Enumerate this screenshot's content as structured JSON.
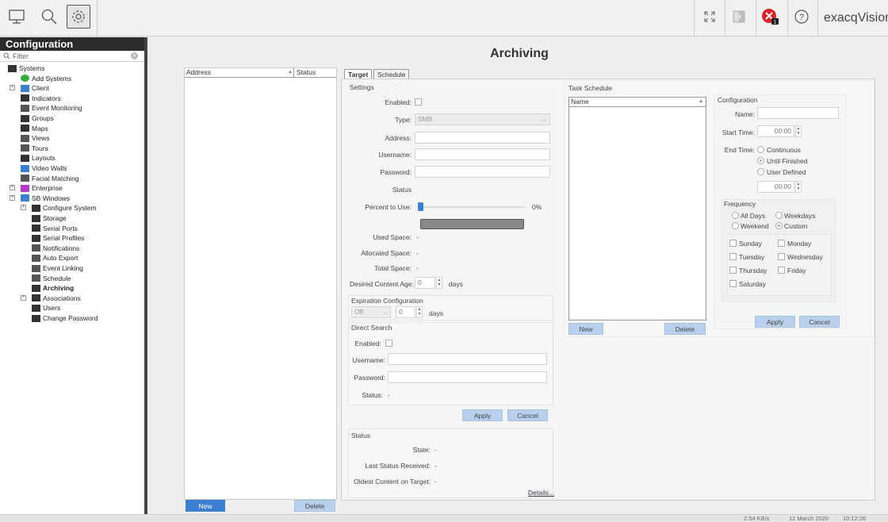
{
  "toolbar": {
    "brand": "exacqVision"
  },
  "sidebar": {
    "title": "Configuration",
    "filter_placeholder": "Filter",
    "items": [
      {
        "label": "Systems"
      },
      {
        "label": "Add Systems"
      },
      {
        "label": "Client"
      },
      {
        "label": "Indicators"
      },
      {
        "label": "Event Monitoring"
      },
      {
        "label": "Groups"
      },
      {
        "label": "Maps"
      },
      {
        "label": "Views"
      },
      {
        "label": "Tours"
      },
      {
        "label": "Layouts"
      },
      {
        "label": "Video Walls"
      },
      {
        "label": "Facial Matching"
      },
      {
        "label": "Enterprise"
      },
      {
        "label": "SB Windows"
      },
      {
        "label": "Configure System"
      },
      {
        "label": "Storage"
      },
      {
        "label": "Serial Ports"
      },
      {
        "label": "Serial Profiles"
      },
      {
        "label": "Notifications"
      },
      {
        "label": "Auto Export"
      },
      {
        "label": "Event Linking"
      },
      {
        "label": "Schedule"
      },
      {
        "label": "Archiving"
      },
      {
        "label": "Associations"
      },
      {
        "label": "Users"
      },
      {
        "label": "Change Password"
      }
    ]
  },
  "main": {
    "title": "Archiving",
    "list": {
      "columns": [
        "Address",
        "Status"
      ],
      "new_label": "New",
      "delete_label": "Delete"
    },
    "tabs": [
      "Target",
      "Schedule"
    ],
    "settings": {
      "heading": "Settings",
      "enabled_label": "Enabled:",
      "type_label": "Type:",
      "type_value": "SMB",
      "address_label": "Address:",
      "username_label": "Username:",
      "password_label": "Password:",
      "status_label": "Status",
      "percent_label": "Percent to Use:",
      "percent_value": "0%",
      "percent_fraction": 0,
      "used_label": "Used Space:",
      "used_value": "-",
      "allocated_label": "Allocated Space:",
      "allocated_value": "-",
      "total_label": "Total Space:",
      "total_value": "-",
      "content_age_label": "Desired Content Age:",
      "content_age_value": "0",
      "content_age_unit": "days"
    },
    "expiration": {
      "heading": "Expiration Configuration",
      "mode_value": "Off",
      "days_value": "0",
      "unit": "days"
    },
    "direct_search": {
      "heading": "Direct Search",
      "enabled_label": "Enabled:",
      "username_label": "Username:",
      "password_label": "Password:",
      "status_label": "Status:",
      "status_value": "-"
    },
    "target_buttons": {
      "apply": "Apply",
      "cancel": "Cancel"
    },
    "status_section": {
      "heading": "Status",
      "state_label": "State:",
      "state_value": "-",
      "last_received_label": "Last Status Received:",
      "last_received_value": "-",
      "oldest_label": "Oldest Content on Target:",
      "oldest_value": "-",
      "details_link": "Details..."
    },
    "task_schedule": {
      "heading": "Task Schedule",
      "column": "Name",
      "new_label": "New",
      "delete_label": "Delete"
    },
    "schedule_config": {
      "heading": "Configuration",
      "name_label": "Name:",
      "start_label": "Start Time:",
      "start_value": "00:00",
      "end_label": "End Time:",
      "end_options": [
        "Continuous",
        "Until Finished",
        "User Defined"
      ],
      "end_time_value": "00:00",
      "frequency_heading": "Frequency",
      "freq_options": [
        "All Days",
        "Weekdays",
        "Weekend",
        "Custom"
      ],
      "days": [
        "Sunday",
        "Monday",
        "Tuesday",
        "Wednesday",
        "Thursday",
        "Friday",
        "Saturday"
      ],
      "apply": "Apply",
      "cancel": "Cancel"
    }
  },
  "statusbar": {
    "rate": "2.54 KB/s",
    "date": "12 March 2020",
    "time": "10:12:26"
  },
  "colors": {
    "accent": "#3c7fd1",
    "button_light": "#b8d0ec",
    "sidebar_title_bg": "#2b2b2b",
    "error_badge": "#d8232a"
  }
}
